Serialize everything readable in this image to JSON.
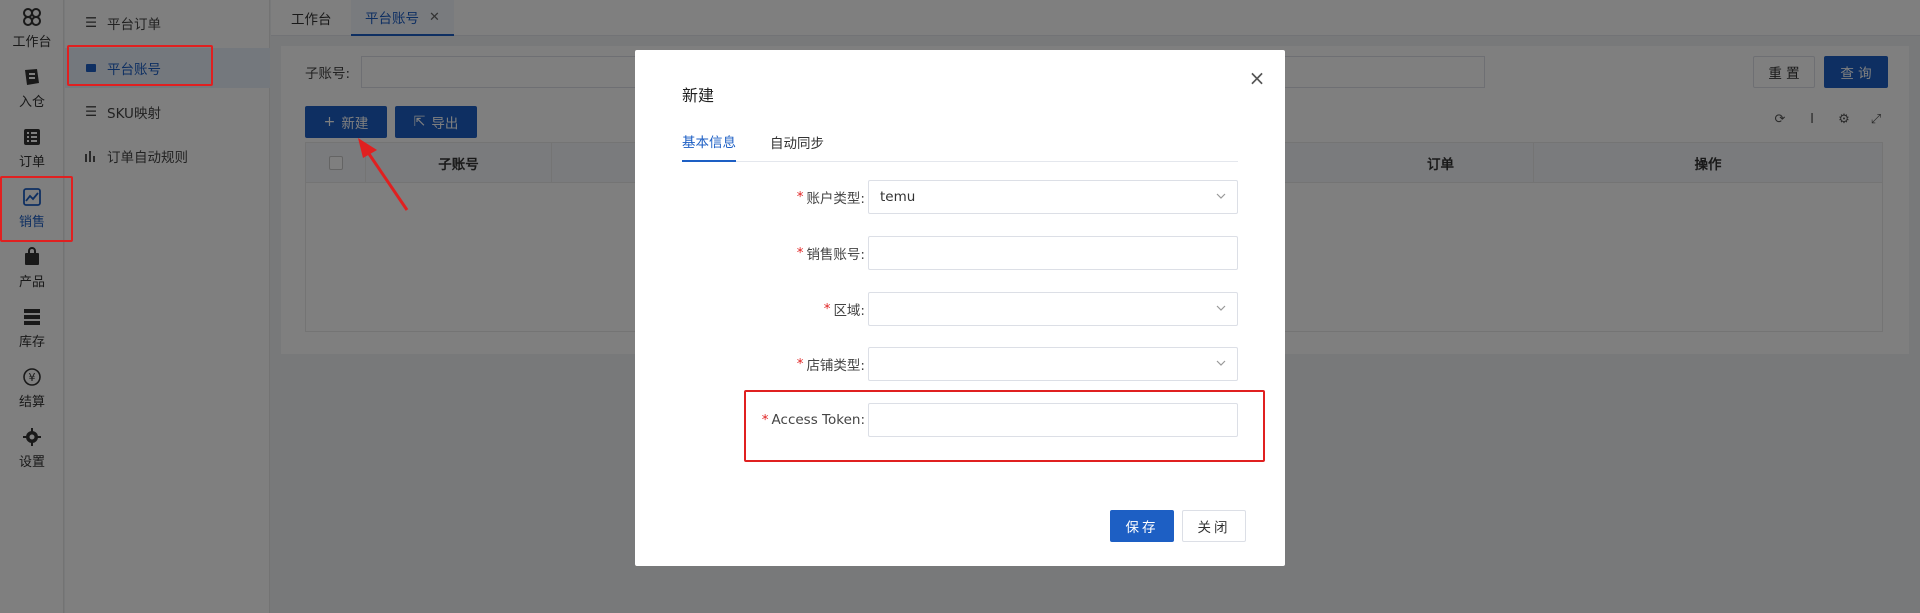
{
  "rail": {
    "items": [
      {
        "label": "工作台",
        "icon": "workbench-icon"
      },
      {
        "label": "入仓",
        "icon": "inbound-icon"
      },
      {
        "label": "订单",
        "icon": "order-icon"
      },
      {
        "label": "销售",
        "icon": "sales-icon"
      },
      {
        "label": "产品",
        "icon": "product-icon"
      },
      {
        "label": "库存",
        "icon": "inventory-icon"
      },
      {
        "label": "结算",
        "icon": "settlement-icon"
      },
      {
        "label": "设置",
        "icon": "settings-icon"
      }
    ]
  },
  "submenu": {
    "items": [
      {
        "label": "平台订单"
      },
      {
        "label": "平台账号"
      },
      {
        "label": "SKU映射"
      },
      {
        "label": "订单自动规则"
      }
    ]
  },
  "tabs": {
    "items": [
      {
        "label": "工作台"
      },
      {
        "label": "平台账号",
        "close": "✕"
      }
    ]
  },
  "filter": {
    "sub_account_label": "子账号:",
    "reset_label": "重 置",
    "query_label": "查 询"
  },
  "toolbar": {
    "new_label": "新建",
    "export_label": "导出"
  },
  "table": {
    "headers": [
      "子账号",
      "订单",
      "操作"
    ]
  },
  "dialog": {
    "title": "新建",
    "tabs": [
      "基本信息",
      "自动同步"
    ],
    "fields": [
      {
        "label": "账户类型:",
        "value": "temu",
        "required": "*"
      },
      {
        "label": "销售账号:",
        "value": "",
        "required": "*"
      },
      {
        "label": "区域:",
        "value": "",
        "required": "*"
      },
      {
        "label": "店铺类型:",
        "value": "",
        "required": "*"
      },
      {
        "label": "Access Token:",
        "value": "",
        "required": "*"
      }
    ],
    "save_label": "保存",
    "close_label": "关闭"
  },
  "colors": {
    "primary": "#1d5fc4",
    "annotation": "#e02020"
  }
}
